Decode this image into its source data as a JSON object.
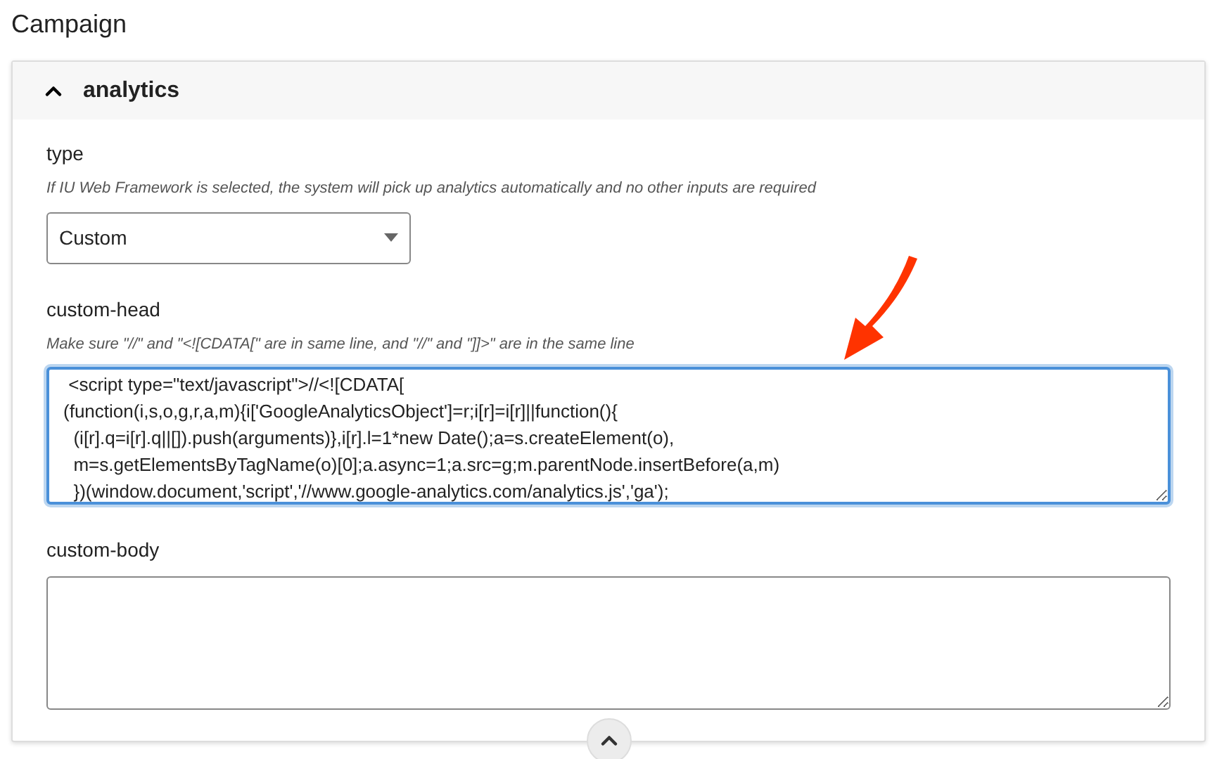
{
  "page_title": "Campaign",
  "section": {
    "title": "analytics",
    "expanded": true,
    "fields": [
      {
        "kind": "select",
        "label": "type",
        "hint": "If IU Web Framework is selected, the system will pick up analytics automatically and no other inputs are required",
        "value": "Custom"
      },
      {
        "kind": "textarea",
        "label": "custom-head",
        "hint": "Make sure \"//\" and \"<![CDATA[\" are in same line, and \"//\" and \"]]>\" are in the same line",
        "focused": true,
        "value_lines": [
          " <script type=\"text/javascript\">//<![CDATA[",
          "(function(i,s,o,g,r,a,m){i['GoogleAnalyticsObject']=r;i[r]=i[r]||function(){",
          "  (i[r].q=i[r].q||[]).push(arguments)},i[r].l=1*new Date();a=s.createElement(o),",
          "  m=s.getElementsByTagName(o)[0];a.async=1;a.src=g;m.parentNode.insertBefore(a,m)",
          "  })(window.document,'script','//www.google-analytics.com/analytics.js','ga');"
        ]
      },
      {
        "kind": "textarea",
        "label": "custom-body",
        "focused": false
      }
    ]
  }
}
